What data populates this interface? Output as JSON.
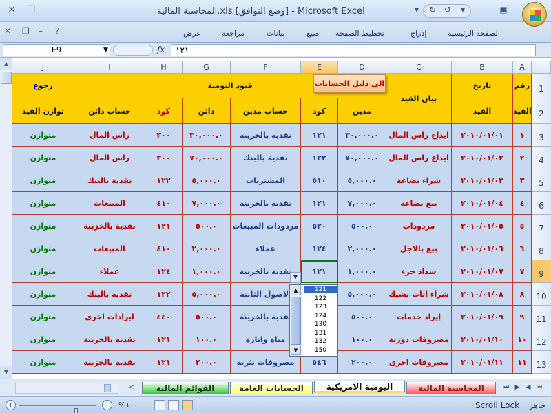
{
  "window": {
    "title": "المحاسبة المالية.xls  [وضع التوافق] - Microsoft Excel"
  },
  "ribbon": {
    "tabs": [
      "الصفحة الرئيسية",
      "إدراج",
      "تخطيط الصفحة",
      "صيغ",
      "بيانات",
      "مراجعة",
      "عرض"
    ]
  },
  "formula_bar": {
    "name_box": "E9",
    "fx": "fx",
    "formula": "١٢١"
  },
  "columns": [
    "A",
    "B",
    "C",
    "D",
    "E",
    "F",
    "G",
    "H",
    "I",
    "J"
  ],
  "selected_column": "E",
  "rows_numbers": [
    "1",
    "2",
    "3",
    "4",
    "5",
    "6",
    "7",
    "8",
    "9",
    "10",
    "11",
    "12",
    "13"
  ],
  "selected_row": "9",
  "headers": {
    "rakm1": "رقم",
    "rakm2": "القيد",
    "date1": "تاريخ",
    "date2": "القيد",
    "desc": "بيان القيد",
    "journal": "قيود اليومية",
    "back": "رجوع",
    "madin": "مدين",
    "code_e": "كود",
    "hesab_madin": "حساب مدين",
    "dain": "دائن",
    "code_h": "كود",
    "hesab_dain": "حساب دائن",
    "balance": "توازن القيد"
  },
  "buttons": {
    "chart_of_accounts": "الى دليل الحسابات"
  },
  "rows": [
    {
      "n": "١",
      "date": "٢٠١٠/٠١/٠١",
      "desc": "ايداع راس المال",
      "madin": "٣٠,٠٠٠.٠",
      "code_e": "١٢١",
      "hesab_madin": "نقدية بالخزينة",
      "dain": "٣٠,٠٠٠.٠",
      "code_h": "٣٠٠",
      "hesab_dain": "راس المال",
      "balance": "متوازن"
    },
    {
      "n": "٢",
      "date": "٢٠١٠/٠١/٠٢",
      "desc": "ايداع راس المال",
      "madin": "٧٠,٠٠٠.٠",
      "code_e": "١٢٢",
      "hesab_madin": "نقدية بالبنك",
      "dain": "٧٠,٠٠٠.٠",
      "code_h": "٣٠٠",
      "hesab_dain": "راس المال",
      "balance": "متوازن"
    },
    {
      "n": "٣",
      "date": "٢٠١٠/٠١/٠٣",
      "desc": "شراء بضاعة",
      "madin": "٥,٠٠٠.٠",
      "code_e": "٥١٠",
      "hesab_madin": "المشتريات",
      "dain": "٥,٠٠٠.٠",
      "code_h": "١٢٢",
      "hesab_dain": "نقدية بالبنك",
      "balance": "متوازن"
    },
    {
      "n": "٤",
      "date": "٢٠١٠/٠١/٠٤",
      "desc": "بيع بضاعة",
      "madin": "٧,٠٠٠.٠",
      "code_e": "١٢١",
      "hesab_madin": "نقدية بالخزينة",
      "dain": "٧,٠٠٠.٠",
      "code_h": "٤١٠",
      "hesab_dain": "المبيعات",
      "balance": "متوازن"
    },
    {
      "n": "٥",
      "date": "٢٠١٠/٠١/٠٥",
      "desc": "مردودات",
      "madin": "٥٠٠.٠",
      "code_e": "٥٢٠",
      "hesab_madin": "مردودات المبيعات",
      "dain": "٥٠٠.٠",
      "code_h": "١٢١",
      "hesab_dain": "نقدية بالخزينة",
      "balance": "متوازن"
    },
    {
      "n": "٦",
      "date": "٢٠١٠/٠١/٠٦",
      "desc": "بيع بالاجل",
      "madin": "٢,٠٠٠.٠",
      "code_e": "١٢٤",
      "hesab_madin": "عملاء",
      "dain": "٢,٠٠٠.٠",
      "code_h": "٤١٠",
      "hesab_dain": "المبيعات",
      "balance": "متوازن"
    },
    {
      "n": "٧",
      "date": "٢٠١٠/٠١/٠٧",
      "desc": "سداد جزء",
      "madin": "١,٠٠٠.٠",
      "code_e": "١٢١",
      "hesab_madin": "نقدية بالخزينة",
      "dain": "١,٠٠٠.٠",
      "code_h": "١٢٤",
      "hesab_dain": "عملاء",
      "balance": "متوازن"
    },
    {
      "n": "٨",
      "date": "٢٠١٠/٠١/٠٨",
      "desc": "شراء اثاث بشيك",
      "madin": "٥,٠٠٠.٠",
      "code_e": "",
      "hesab_madin": "الاصول الثابتة",
      "dain": "٥,٠٠٠.٠",
      "code_h": "١٢٢",
      "hesab_dain": "نقدية بالبنك",
      "balance": "متوازن"
    },
    {
      "n": "٩",
      "date": "٢٠١٠/٠١/٠٩",
      "desc": "إيراد خدمات",
      "madin": "٥٠٠.٠",
      "code_e": "",
      "hesab_madin": "نقدية بالخزينة",
      "dain": "٥٠٠.٠",
      "code_h": "٤٤٠",
      "hesab_dain": "ايرادات اخرى",
      "balance": "متوازن"
    },
    {
      "n": "١٠",
      "date": "٢٠١٠/٠١/١٠",
      "desc": "مصروفات دورية",
      "madin": "١٠٠.٠",
      "code_e": "",
      "hesab_madin": "مياة وانارة",
      "dain": "١٠٠.٠",
      "code_h": "١٢١",
      "hesab_dain": "نقدية بالخزينة",
      "balance": "متوازن"
    },
    {
      "n": "١١",
      "date": "٢٠١٠/٠١/١١",
      "desc": "مصروفات اخرى",
      "madin": "٢٠٠.٠",
      "code_e": "٥٤٦",
      "hesab_madin": "مصروفات نثرية",
      "dain": "٢٠٠.٠",
      "code_h": "١٢١",
      "hesab_dain": "نقدية بالخزينة",
      "balance": "متوازن"
    }
  ],
  "dropdown": {
    "options": [
      "121",
      "122",
      "123",
      "124",
      "130",
      "131",
      "132",
      "150"
    ],
    "selected": "121"
  },
  "sheet_tabs": [
    {
      "label": "المحاسبة المالية",
      "color": "#ff5a5a",
      "active": false
    },
    {
      "label": "اليومية الامريكية",
      "color": "#ffd966",
      "active": true
    },
    {
      "label": "الحسابات العامة",
      "color": "#ffff66",
      "active": false
    },
    {
      "label": "القوائم المالية",
      "color": "#33cc33",
      "active": false
    }
  ],
  "status": {
    "ready": "جاهز",
    "scroll_lock": "Scroll Lock",
    "zoom": "%١٠٠"
  },
  "colors": {
    "header_fill": "#fcd000",
    "body_fill": "#c6d9f1",
    "grid_border": "#c0392b",
    "balance_text": "#007a00"
  }
}
